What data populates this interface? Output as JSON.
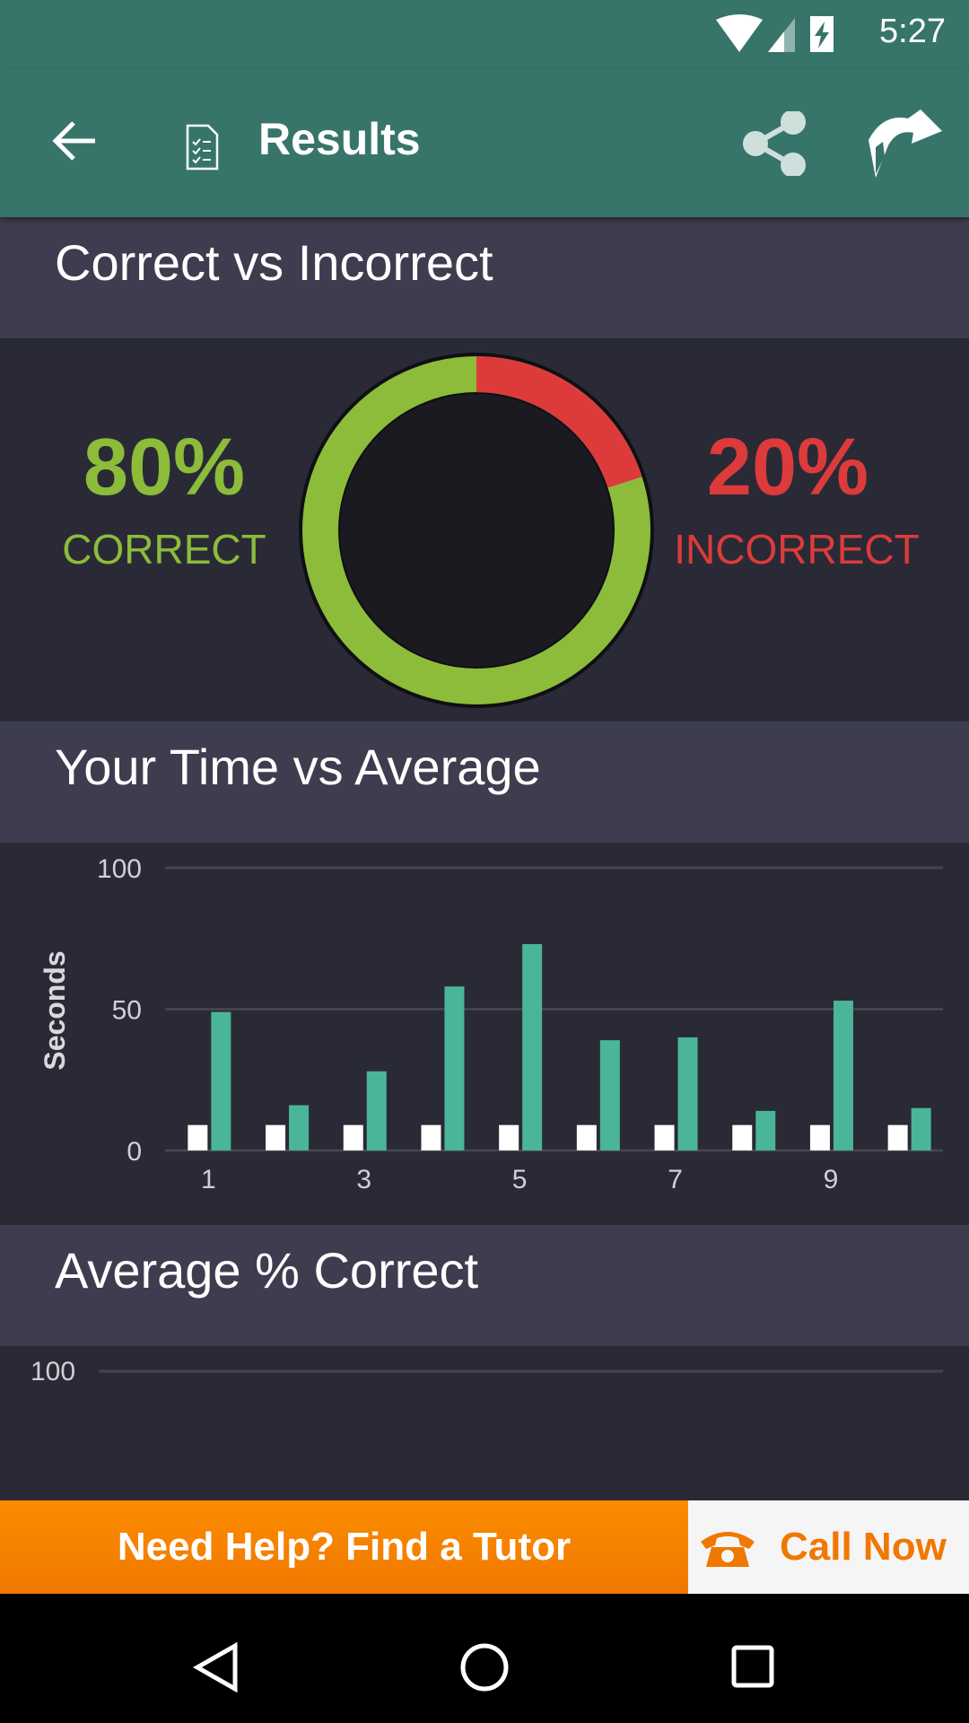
{
  "status_bar": {
    "time": "5:27",
    "icons": [
      "wifi-icon",
      "signal-icon",
      "battery-charging-icon"
    ]
  },
  "app_bar": {
    "title": "Results",
    "icons": [
      "back-arrow-icon",
      "checklist-document-icon",
      "share-icon",
      "forward-icon"
    ]
  },
  "sections": {
    "correct": {
      "title": "Correct vs Incorrect",
      "correct_pct": "80%",
      "correct_label": "CORRECT",
      "incorrect_pct": "20%",
      "incorrect_label": "INCORRECT",
      "correct_value": 80,
      "incorrect_value": 20,
      "correct_color": "#8cbc3a",
      "incorrect_color": "#dd3b3b"
    },
    "time": {
      "title": "Your Time vs Average"
    },
    "avg": {
      "title": "Average % Correct"
    }
  },
  "chart_data": [
    {
      "type": "bar",
      "ylabel": "Seconds",
      "ylim": [
        0,
        100
      ],
      "yticks": [
        "0",
        "50",
        "100"
      ],
      "categories": [
        1,
        2,
        3,
        4,
        5,
        6,
        7,
        8,
        9,
        10
      ],
      "xticks": [
        "1",
        "3",
        "5",
        "7",
        "9"
      ],
      "grid": true,
      "series": [
        {
          "color": "#ffffff",
          "values": [
            9,
            9,
            9,
            9,
            9,
            9,
            9,
            9,
            9,
            9
          ]
        },
        {
          "color": "#4ab598",
          "values": [
            49,
            16,
            28,
            58,
            73,
            39,
            40,
            14,
            53,
            15
          ]
        }
      ]
    },
    {
      "type": "bar",
      "ylim": [
        0,
        100
      ],
      "yticks": [
        "100"
      ],
      "grid": true
    }
  ],
  "banner": {
    "text": "Need Help? Find a Tutor",
    "call_label": "Call Now",
    "call_icon": "phone-icon"
  },
  "nav_bar": {
    "icons": [
      "back-triangle-icon",
      "home-circle-icon",
      "recents-square-icon"
    ]
  }
}
